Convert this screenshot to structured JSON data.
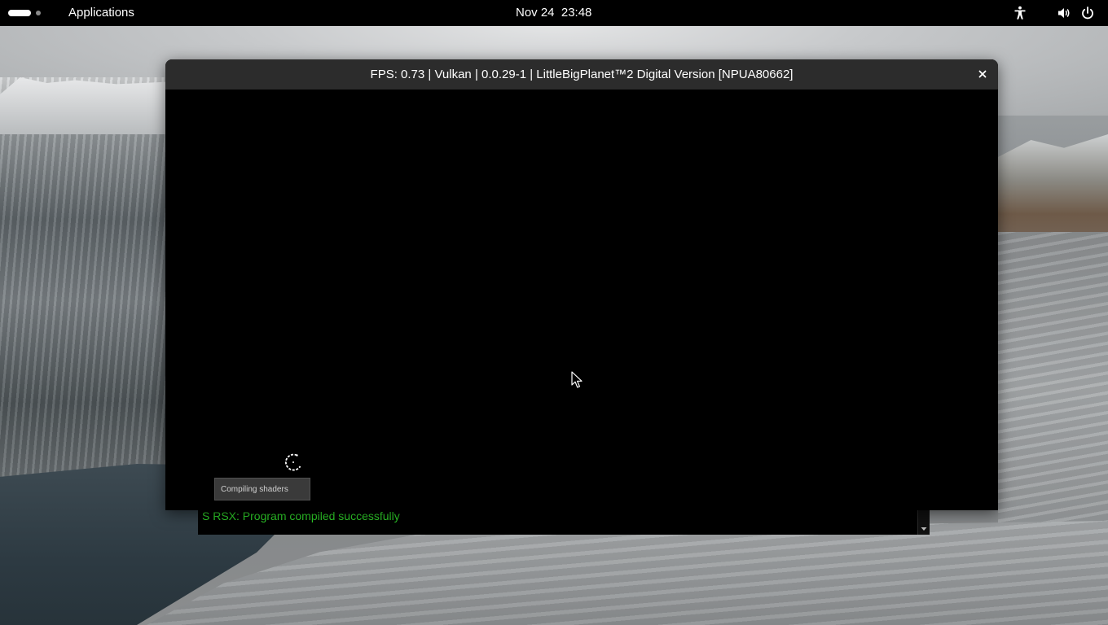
{
  "topbar": {
    "activities_label": "Activities",
    "applications_label": "Applications",
    "clock": "Nov 24  23:48",
    "icons": [
      "accessibility-icon",
      "volume-icon",
      "power-icon"
    ]
  },
  "game_window": {
    "title": "FPS: 0.73 | Vulkan | 0.0.29-1 | LittleBigPlanet™2 Digital Version [NPUA80662]",
    "close_icon": "close-icon",
    "toast_text": "Compiling shaders",
    "spinner_icon": "loading-spinner-icon"
  },
  "log_window": {
    "line": "S RSX: Program compiled successfully",
    "line_color": "#2fd12a"
  },
  "colors": {
    "topbar_bg": "#000000",
    "titlebar_bg": "#2c2c2c",
    "viewport_bg": "#000000"
  }
}
